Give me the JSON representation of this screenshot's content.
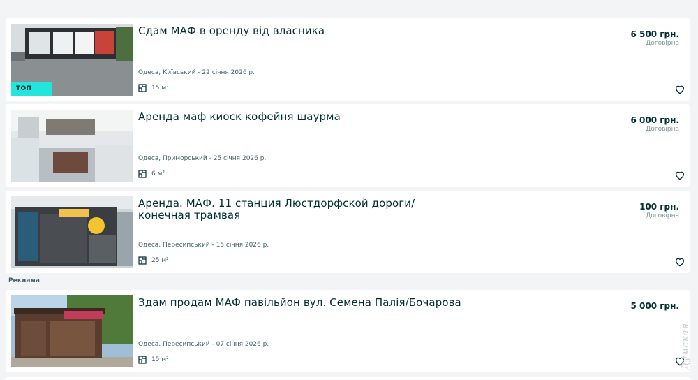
{
  "listings": [
    {
      "title": "Сдам МАФ в оренду від власника",
      "price": "6 500 грн.",
      "negotiable": "Договірна",
      "meta": "Одеса, Київський - 22 січня 2026 р.",
      "area": "15 м²",
      "badge": "ТОП"
    },
    {
      "title": "Аренда маф киоск кофейня шаурма",
      "price": "6 000 грн.",
      "negotiable": "Договірна",
      "meta": "Одеса, Приморський - 25 січня 2026 р.",
      "area": "6 м²"
    },
    {
      "title": "Аренда. МАФ. 11 станция Люстдорфской дороги/конечная трамвая",
      "price": "100 грн.",
      "negotiable": "Договірна",
      "meta": "Одеса, Пересипський - 15 січня 2026 р.",
      "area": "25 м²"
    },
    {
      "title": "Здам продам МАФ павільйон вул. Семена Палія/Бочарова",
      "price": "5 000 грн.",
      "meta": "Одеса, Пересипський - 07 січня 2026 р.",
      "area": "15 м²"
    }
  ],
  "ad_label": "Реклама",
  "watermark": "Думская",
  "icons": {
    "area": "floor-plan-icon",
    "favorite": "heart-outline-icon"
  },
  "colors": {
    "background": "#f2f4f5",
    "card": "#ffffff",
    "text": "#002f34",
    "secondary": "#406367",
    "top_badge": "#23e5db"
  }
}
